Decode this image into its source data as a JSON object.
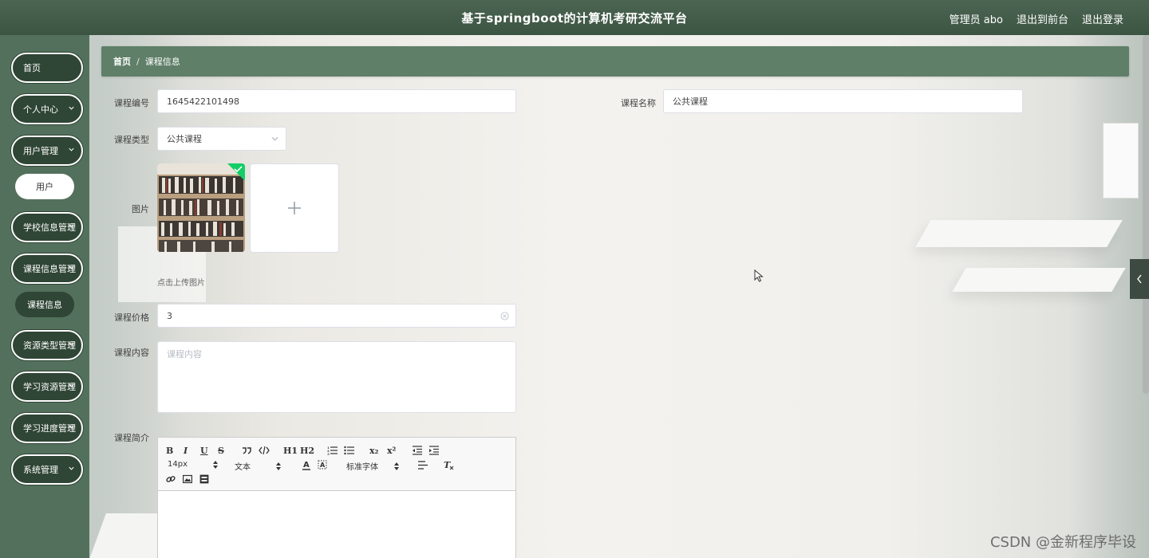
{
  "header": {
    "title": "基于springboot的计算机考研交流平台",
    "user_label": "管理员 abo",
    "back_to_front": "退出到前台",
    "logout": "退出登录"
  },
  "sidebar": {
    "items": [
      {
        "label": "首页"
      },
      {
        "label": "个人中心"
      },
      {
        "label": "用户管理"
      },
      {
        "label": "学校信息管理"
      },
      {
        "label": "课程信息管理"
      },
      {
        "label": "资源类型管理"
      },
      {
        "label": "学习资源管理"
      },
      {
        "label": "学习进度管理"
      },
      {
        "label": "系统管理"
      }
    ],
    "sub_users": "用户",
    "sub_course_info": "课程信息"
  },
  "breadcrumb": {
    "home": "首页",
    "separator": "/",
    "current": "课程信息"
  },
  "form": {
    "course_no_label": "课程编号",
    "course_no_value": "1645422101498",
    "course_name_label": "课程名称",
    "course_name_value": "公共课程",
    "course_type_label": "课程类型",
    "course_type_value": "公共课程",
    "image_label": "图片",
    "upload_tip": "点击上传图片",
    "price_label": "课程价格",
    "price_value": "3",
    "content_label": "课程内容",
    "content_placeholder": "课程内容",
    "intro_label": "课程简介"
  },
  "editor": {
    "font_size": "14px",
    "paragraph": "文本",
    "font_family": "标准字体",
    "bold": "B",
    "italic": "I",
    "underline": "U",
    "strike": "S",
    "h1": "H1",
    "h2": "H2",
    "sub": "x₂",
    "sup": "x²"
  },
  "watermark": "CSDN @金新程序毕设",
  "colors": {
    "header": "#3c5442",
    "sidebar": "#53705c",
    "menu_item": "#2f4535",
    "breadcrumb": "#5f7f68"
  }
}
